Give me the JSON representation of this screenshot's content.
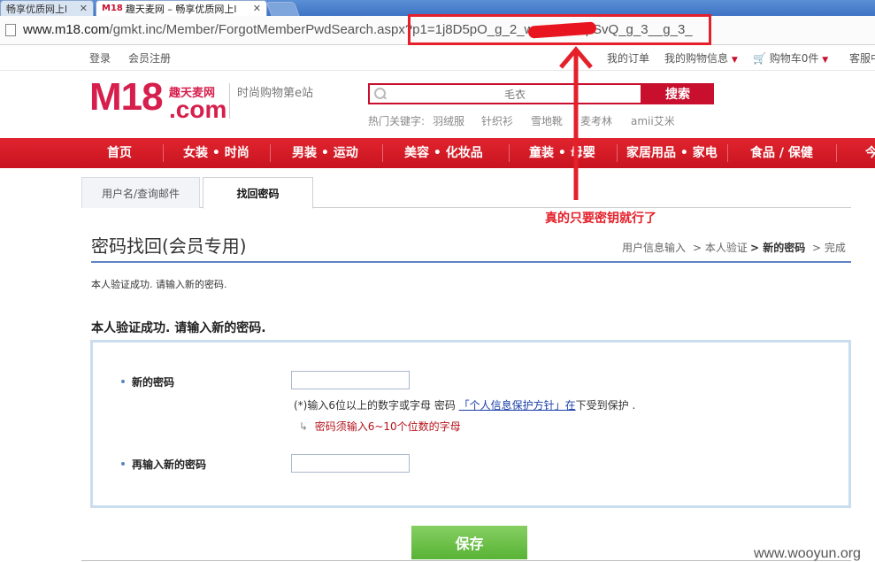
{
  "browser": {
    "tabs": [
      {
        "label": "畅享优质网上l"
      },
      {
        "prefix": "M18",
        "label": "趣天麦网 – 畅享优质网上l"
      }
    ],
    "url_main": "www.m18.com",
    "url_path": "/gmkt.inc/Member/ForgotMemberPwdSearch.aspx?p1=1j8D5pO_g_2_w",
    "url_tail": "npSvQ_g_3__g_3_"
  },
  "topbar": {
    "login": "登录",
    "register": "会员注册",
    "my_orders": "我的订单",
    "my_shopping_info": "我的购物信息",
    "cart": "购物车0件",
    "service": "客服中"
  },
  "logo": {
    "brand": "M18",
    "brand_cn": "趣天麦网",
    "domain": ".com",
    "slogan": "时尚购物第e站"
  },
  "search": {
    "placeholder": "毛衣",
    "button": "搜索",
    "hot_label": "热门关键字:",
    "hot_keywords": [
      "羽绒服",
      "针织衫",
      "雪地靴",
      "麦考林",
      "amii艾米"
    ]
  },
  "nav": [
    "首页",
    "女装 • 时尚",
    "男装 • 运动",
    "美容 • 化妆品",
    "童装 • 母婴",
    "家居用品 • 家电",
    "食品 / 保健",
    "今"
  ],
  "tabs": {
    "tab1": "用户名/查询邮件",
    "tab2": "找回密码"
  },
  "annotation": "真的只要密钥就行了",
  "page": {
    "title": "密码找回(会员专用)",
    "steps": [
      "用户信息输入",
      "> 本人验证",
      "> 新的密码",
      "> 完成"
    ],
    "note_small": "本人验证成功. 请输入新的密码.",
    "note_bold": "本人验证成功. 请输入新的密码."
  },
  "form": {
    "new_pwd_label": "新的密码",
    "hint_prefix": "(*)输入6位以上的数字或字母 密码 ",
    "hint_link": "「个人信息保护方针」在",
    "hint_suffix": "下受到保护 .",
    "error": "密码须输入6~10个位数的字母",
    "confirm_label": "再输入新的密码",
    "save": "保存"
  },
  "watermark": "www.wooyun.org"
}
